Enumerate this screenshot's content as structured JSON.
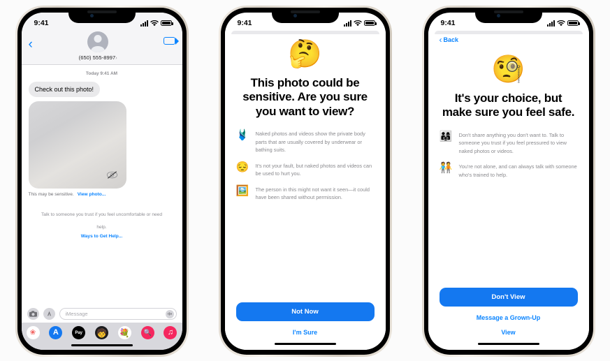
{
  "phone1": {
    "status": {
      "time": "9:41",
      "signal_icon": "cellular-bars-icon",
      "wifi_icon": "wifi-icon",
      "battery_icon": "battery-icon"
    },
    "header": {
      "back_icon": "chevron-left-icon",
      "avatar": "contact-avatar",
      "contact_name": "(650) 555-8997",
      "contact_chevron": "›",
      "facetime_icon": "video-camera-icon"
    },
    "conversation": {
      "timestamp": "Today 9:41 AM",
      "incoming_message": "Check out this photo!",
      "photo_hidden_icon": "eye-slash-icon",
      "sensitive_notice": "This may be sensitive.",
      "view_photo_link": "View photo...",
      "help_text": "Talk to someone you trust if you feel uncomfortable or need help.",
      "help_link": "Ways to Get Help..."
    },
    "compose": {
      "camera_icon": "camera-icon",
      "appstore_icon": "app-store-icon",
      "placeholder": "iMessage",
      "audio_icon": "audio-waveform-icon"
    },
    "app_drawer": [
      {
        "name": "photos-app-icon",
        "glyph": "❀",
        "bg": "#ffffff",
        "color": "#f25f5c"
      },
      {
        "name": "app-store-app-icon",
        "glyph": "A",
        "bg": "#1478f0",
        "color": "#ffffff"
      },
      {
        "name": "apple-pay-app-icon",
        "glyph": "Pay",
        "bg": "#000000",
        "color": "#ffffff"
      },
      {
        "name": "memoji-app-icon",
        "glyph": "🧒",
        "bg": "#1c1c1e",
        "color": "#ffffff"
      },
      {
        "name": "stickers-app-icon",
        "glyph": "💐",
        "bg": "#ffffff",
        "color": "#000000"
      },
      {
        "name": "image-search-app-icon",
        "glyph": "🔍",
        "bg": "#f5275f",
        "color": "#ffffff"
      },
      {
        "name": "music-app-icon",
        "glyph": "♫",
        "bg": "#f5275f",
        "color": "#ffffff"
      }
    ]
  },
  "phone2": {
    "status": {
      "time": "9:41",
      "signal_icon": "cellular-bars-icon",
      "wifi_icon": "wifi-icon",
      "battery_icon": "battery-icon"
    },
    "hero_emoji": "🤔",
    "title": "This photo could be sensitive. Are you sure you want to view?",
    "bullets": [
      {
        "emoji": "🩱",
        "text": "Naked photos and videos show the private body parts that are usually covered by underwear or bathing suits."
      },
      {
        "emoji": "😔",
        "text": "It's not your fault, but naked photos and videos can be used to hurt you."
      },
      {
        "emoji": "🖼️",
        "text": "The person in this might not want it seen—it could have been shared without permission."
      }
    ],
    "primary_button": "Not Now",
    "secondary_link": "I'm Sure"
  },
  "phone3": {
    "status": {
      "time": "9:41",
      "signal_icon": "cellular-bars-icon",
      "wifi_icon": "wifi-icon",
      "battery_icon": "battery-icon"
    },
    "back_label": "Back",
    "back_icon": "chevron-left-icon",
    "hero_emoji": "🧐",
    "title": "It's your choice, but make sure you feel safe.",
    "bullets": [
      {
        "emoji": "👨‍👩‍👧",
        "text": "Don't share anything you don't want to. Talk to someone you trust if you feel pressured to view naked photos or videos."
      },
      {
        "emoji": "🧑‍🤝‍🧑",
        "text": "You're not alone, and can always talk with someone who's trained to help."
      }
    ],
    "primary_button": "Don't View",
    "secondary_link": "Message a Grown-Up",
    "tertiary_link": "View"
  },
  "colors": {
    "accent_blue": "#0a84ff",
    "button_blue": "#1478f0",
    "bubble_gray": "#e9e9eb",
    "body_gray": "#8a8a8e",
    "page_bg": "#fbfbfb"
  }
}
